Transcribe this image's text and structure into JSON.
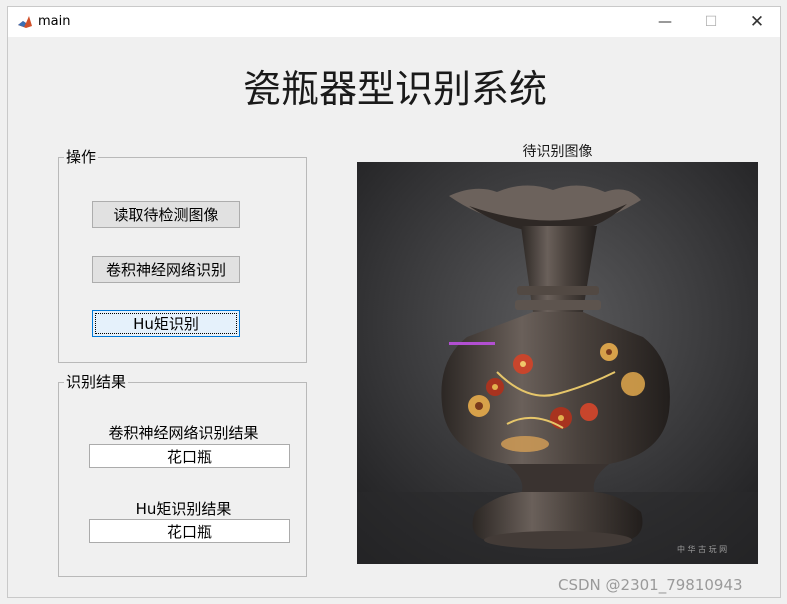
{
  "window": {
    "title": "main",
    "minimize_icon": "—",
    "maximize_icon": "☐",
    "close_icon": "✕"
  },
  "app": {
    "title": "瓷瓶器型识别系统"
  },
  "operations": {
    "legend": "操作",
    "buttons": [
      "读取待检测图像",
      "卷积神经网络识别",
      "Hu矩识别"
    ]
  },
  "results": {
    "legend": "识别结果",
    "cnn_label": "卷积神经网络识别结果",
    "cnn_value": "花口瓶",
    "hu_label": "Hu矩识别结果",
    "hu_value": "花口瓶"
  },
  "image_panel": {
    "title": "待识别图像",
    "image_text": "中 华 古 玩 网"
  },
  "watermark": "CSDN @2301_79810943",
  "colors": {
    "focus_border": "#0078d7",
    "button_bg": "#e1e1e1",
    "vase_body": "#4b433e"
  }
}
